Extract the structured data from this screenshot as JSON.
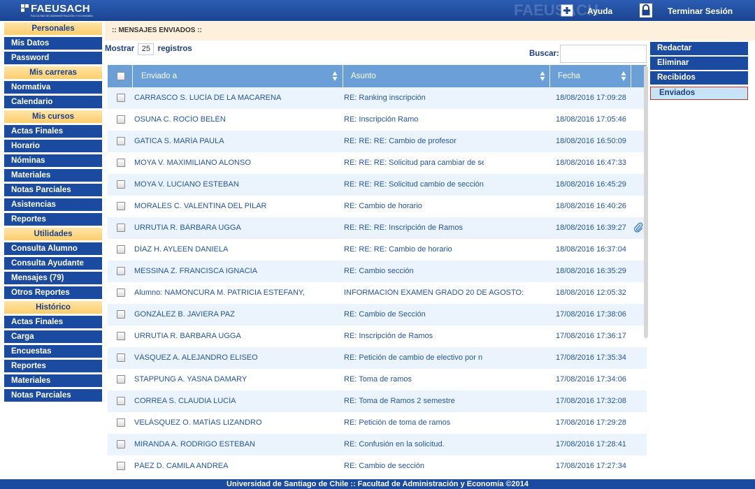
{
  "header": {
    "logo_text": "FAEUSACH",
    "logo_subtitle": "FACULTAD DE ADMINISTRACIÓN Y ECONOMÍA",
    "watermark": "FAEUSACH",
    "help_label": "Ayuda",
    "help_icon": "plus-icon",
    "logout_label": "Terminar Sesión",
    "logout_icon": "lock-icon"
  },
  "sidebar": {
    "sections": [
      {
        "title": "Personales",
        "items": [
          "Mis Datos",
          "Password"
        ]
      },
      {
        "title": "Mis carreras",
        "items": [
          "Normativa",
          "Calendario"
        ]
      },
      {
        "title": "Mis cursos",
        "items": [
          "Actas Finales",
          "Horario",
          "Nóminas",
          "Materiales",
          "Notas Parciales",
          "Asistencias",
          "Reportes"
        ]
      },
      {
        "title": "Utilidades",
        "items": [
          "Consulta Alumno",
          "Consulta Ayudante",
          "Mensajes (79)",
          "Otros Reportes"
        ]
      },
      {
        "title": "Histórico",
        "items": [
          "Actas Finales",
          "Carga",
          "Encuestas",
          "Reportes",
          "Materiales",
          "Notas Parciales"
        ]
      }
    ]
  },
  "main": {
    "title": ":: MENSAJES ENVIADOS ::",
    "show_label": "Mostrar",
    "show_value": "25",
    "records_label": "registros",
    "search_label": "Buscar:",
    "search_value": "",
    "columns": [
      "Enviado a",
      "Asunto",
      "Fecha"
    ],
    "rows": [
      {
        "to": "CARRASCO S. LUCÍA DE LA MACARENA",
        "subject": "RE: Ranking inscripción",
        "date": "18/08/2016 17:09:28",
        "attachment": false
      },
      {
        "to": "OSUNA C. ROCÍO BELÉN",
        "subject": "RE: Inscripción Ramo",
        "date": "18/08/2016 17:05:46",
        "attachment": false
      },
      {
        "to": "GATICA S. MARÍA PAULA",
        "subject": "RE: RE: RE: Cambio de profesor",
        "date": "18/08/2016 16:50:09",
        "attachment": false
      },
      {
        "to": "MOYA V. MAXIMILIANO ALONSO",
        "subject": "RE: RE: RE: Solicitud para cambiar de se",
        "date": "18/08/2016 16:47:33",
        "attachment": false
      },
      {
        "to": "MOYA V. LUCIANO ESTEBAN",
        "subject": "RE: RE: RE: Solicitud cambio de sección",
        "date": "18/08/2016 16:45:29",
        "attachment": false
      },
      {
        "to": "MORALES C. VALENTINA DEL PILAR",
        "subject": "RE: Cambio de horario",
        "date": "18/08/2016 16:40:26",
        "attachment": false
      },
      {
        "to": "URRUTIA R. BÁRBARA UGGA",
        "subject": "RE: RE: RE: Inscripción de Ramos",
        "date": "18/08/2016 16:39:27",
        "attachment": true
      },
      {
        "to": "DÍAZ H. AYLEEN DANIELA",
        "subject": "RE: RE: RE: Cambio de horario",
        "date": "18/08/2016 16:37:04",
        "attachment": false
      },
      {
        "to": "MESSINA Z. FRANCISCA IGNACIA",
        "subject": "RE: Cambio sección",
        "date": "18/08/2016 16:35:29",
        "attachment": false
      },
      {
        "to": "Alumno: NAMONCURA M. PATRICIA ESTEFANY,",
        "subject": "INFORMACIÓN EXAMEN GRADO 20 DE AGOSTO:",
        "date": "18/08/2016 12:05:32",
        "attachment": false
      },
      {
        "to": "GONZÁLEZ B. JAVIERA PAZ",
        "subject": "RE: Cambio de Sección",
        "date": "17/08/2016 17:38:06",
        "attachment": false
      },
      {
        "to": "URRUTIA R. BÁRBARA UGGA",
        "subject": "RE: Inscripción de Ramos",
        "date": "17/08/2016 17:36:17",
        "attachment": false
      },
      {
        "to": "VÁSQUEZ A. ALEJANDRO ELISEO",
        "subject": "RE: Petición de cambio de electivo por n",
        "date": "17/08/2016 17:35:34",
        "attachment": false
      },
      {
        "to": "STAPPUNG A. YASNA DAMARY",
        "subject": "RE: Toma de ramos",
        "date": "17/08/2016 17:34:06",
        "attachment": false
      },
      {
        "to": "CORREA S. CLAUDIA LUCÍA",
        "subject": "RE: Toma de Ramos 2 semestre",
        "date": "17/08/2016 17:32:08",
        "attachment": false
      },
      {
        "to": "VELÁSQUEZ O. MATÍAS LIZANDRO",
        "subject": "RE: Petición de toma de ramos",
        "date": "17/08/2016 17:29:28",
        "attachment": false
      },
      {
        "to": "MIRANDA A. RODRIGO ESTEBAN",
        "subject": "RE: Confusión en la solicitud.",
        "date": "17/08/2016 17:28:41",
        "attachment": false
      },
      {
        "to": "PÁEZ D. CAMILA ANDREA",
        "subject": "RE: Cambio de sección",
        "date": "17/08/2016 17:27:34",
        "attachment": false
      }
    ]
  },
  "right_menu": {
    "items": [
      "Redactar",
      "Eliminar",
      "Recibidos",
      "Enviados"
    ],
    "active": "Enviados"
  },
  "footer": {
    "text": "Universidad de Santiago de Chile :: Facultad de Administración y Economía ©2014"
  },
  "colors": {
    "nav_blue": "#1b4ba0",
    "header_blue": "#6a9fd8",
    "section_gold": "#fccd6b",
    "link_blue": "#2456a8"
  }
}
